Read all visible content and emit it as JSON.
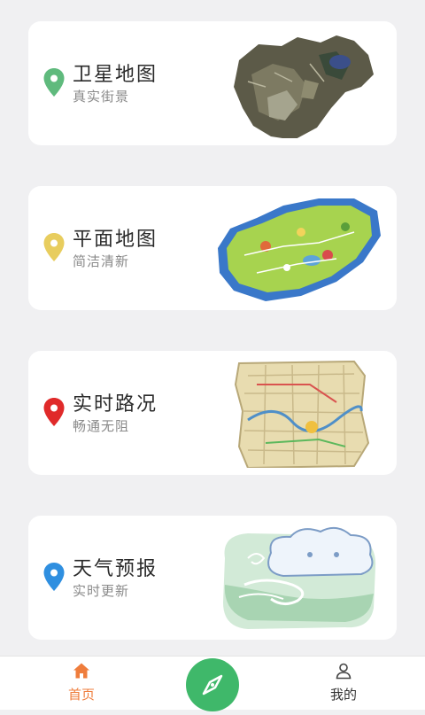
{
  "cards": [
    {
      "title": "卫星地图",
      "subtitle": "真实街景",
      "pin_color": "#5fba7d",
      "icon": "map-pin-icon"
    },
    {
      "title": "平面地图",
      "subtitle": "简洁清新",
      "pin_color": "#e8cd5e",
      "icon": "map-pin-icon"
    },
    {
      "title": "实时路况",
      "subtitle": "畅通无阻",
      "pin_color": "#e02a2a",
      "icon": "map-pin-icon"
    },
    {
      "title": "天气预报",
      "subtitle": "实时更新",
      "pin_color": "#2f8fe0",
      "icon": "map-pin-icon"
    }
  ],
  "tabbar": {
    "home_label": "首页",
    "home_color": "#ef7d3c",
    "center_color": "#3fb86a",
    "mine_label": "我的",
    "center_icon": "compass-icon",
    "home_icon": "home-icon",
    "mine_icon": "user-icon"
  }
}
